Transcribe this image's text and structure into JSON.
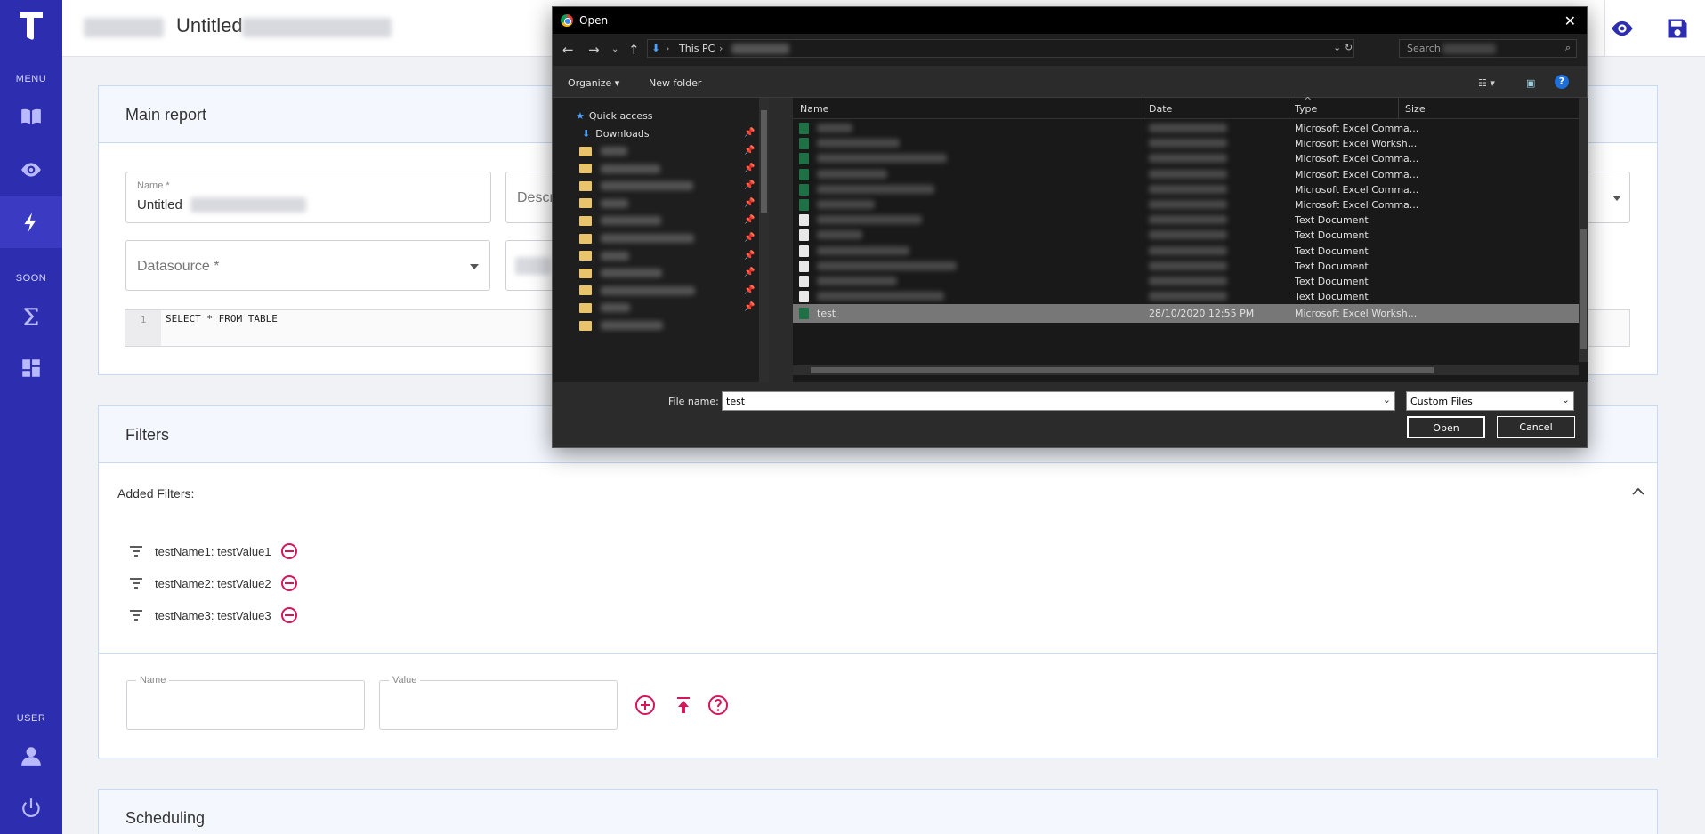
{
  "sidebar": {
    "menu_label": "MENU",
    "soon_label": "SOON",
    "user_label": "USER"
  },
  "topbar": {
    "title": "Untitled"
  },
  "main_report": {
    "title": "Main report",
    "name_label": "Name *",
    "name_value": "Untitled",
    "description_label": "Descri",
    "datasource_placeholder": "Datasource *",
    "code_line_number": "1",
    "code_line": "SELECT * FROM TABLE"
  },
  "filters": {
    "title": "Filters",
    "added_label": "Added Filters:",
    "items": [
      {
        "text": "testName1: testValue1"
      },
      {
        "text": "testName2: testValue2"
      },
      {
        "text": "testName3: testValue3"
      }
    ],
    "name_field_label": "Name",
    "value_field_label": "Value"
  },
  "scheduling": {
    "title": "Scheduling"
  },
  "dialog": {
    "title": "Open",
    "breadcrumb": "This PC",
    "search_placeholder": "Search",
    "organize_label": "Organize",
    "new_folder_label": "New folder",
    "nav_items": [
      {
        "label": "Quick access"
      },
      {
        "label": "Downloads"
      }
    ],
    "columns": {
      "name": "Name",
      "date": "Date",
      "type": "Type",
      "size": "Size"
    },
    "files": [
      {
        "kind": "xl",
        "name": "",
        "date": "",
        "type": "Microsoft Excel Comma..."
      },
      {
        "kind": "xl",
        "name": "",
        "date": "",
        "type": "Microsoft Excel Worksh..."
      },
      {
        "kind": "xl",
        "name": "",
        "date": "",
        "type": "Microsoft Excel Comma..."
      },
      {
        "kind": "xl",
        "name": "",
        "date": "",
        "type": "Microsoft Excel Comma..."
      },
      {
        "kind": "xl",
        "name": "",
        "date": "",
        "type": "Microsoft Excel Comma..."
      },
      {
        "kind": "xl",
        "name": "",
        "date": "",
        "type": "Microsoft Excel Comma..."
      },
      {
        "kind": "txt",
        "name": "",
        "date": "",
        "type": "Text Document"
      },
      {
        "kind": "txt",
        "name": "",
        "date": "",
        "type": "Text Document"
      },
      {
        "kind": "txt",
        "name": "",
        "date": "",
        "type": "Text Document"
      },
      {
        "kind": "txt",
        "name": "",
        "date": "",
        "type": "Text Document"
      },
      {
        "kind": "txt",
        "name": "",
        "date": "",
        "type": "Text Document"
      },
      {
        "kind": "txt",
        "name": "",
        "date": "",
        "type": "Text Document"
      },
      {
        "kind": "xl",
        "name": "test",
        "date": "28/10/2020 12:55 PM",
        "type": "Microsoft Excel Worksh...",
        "selected": true
      }
    ],
    "file_name_label": "File name:",
    "file_name_value": "test",
    "file_type_value": "Custom Files",
    "open_label": "Open",
    "cancel_label": "Cancel"
  },
  "colors": {
    "sidebar": "#2d2db0",
    "accent_red": "#d6165a"
  }
}
